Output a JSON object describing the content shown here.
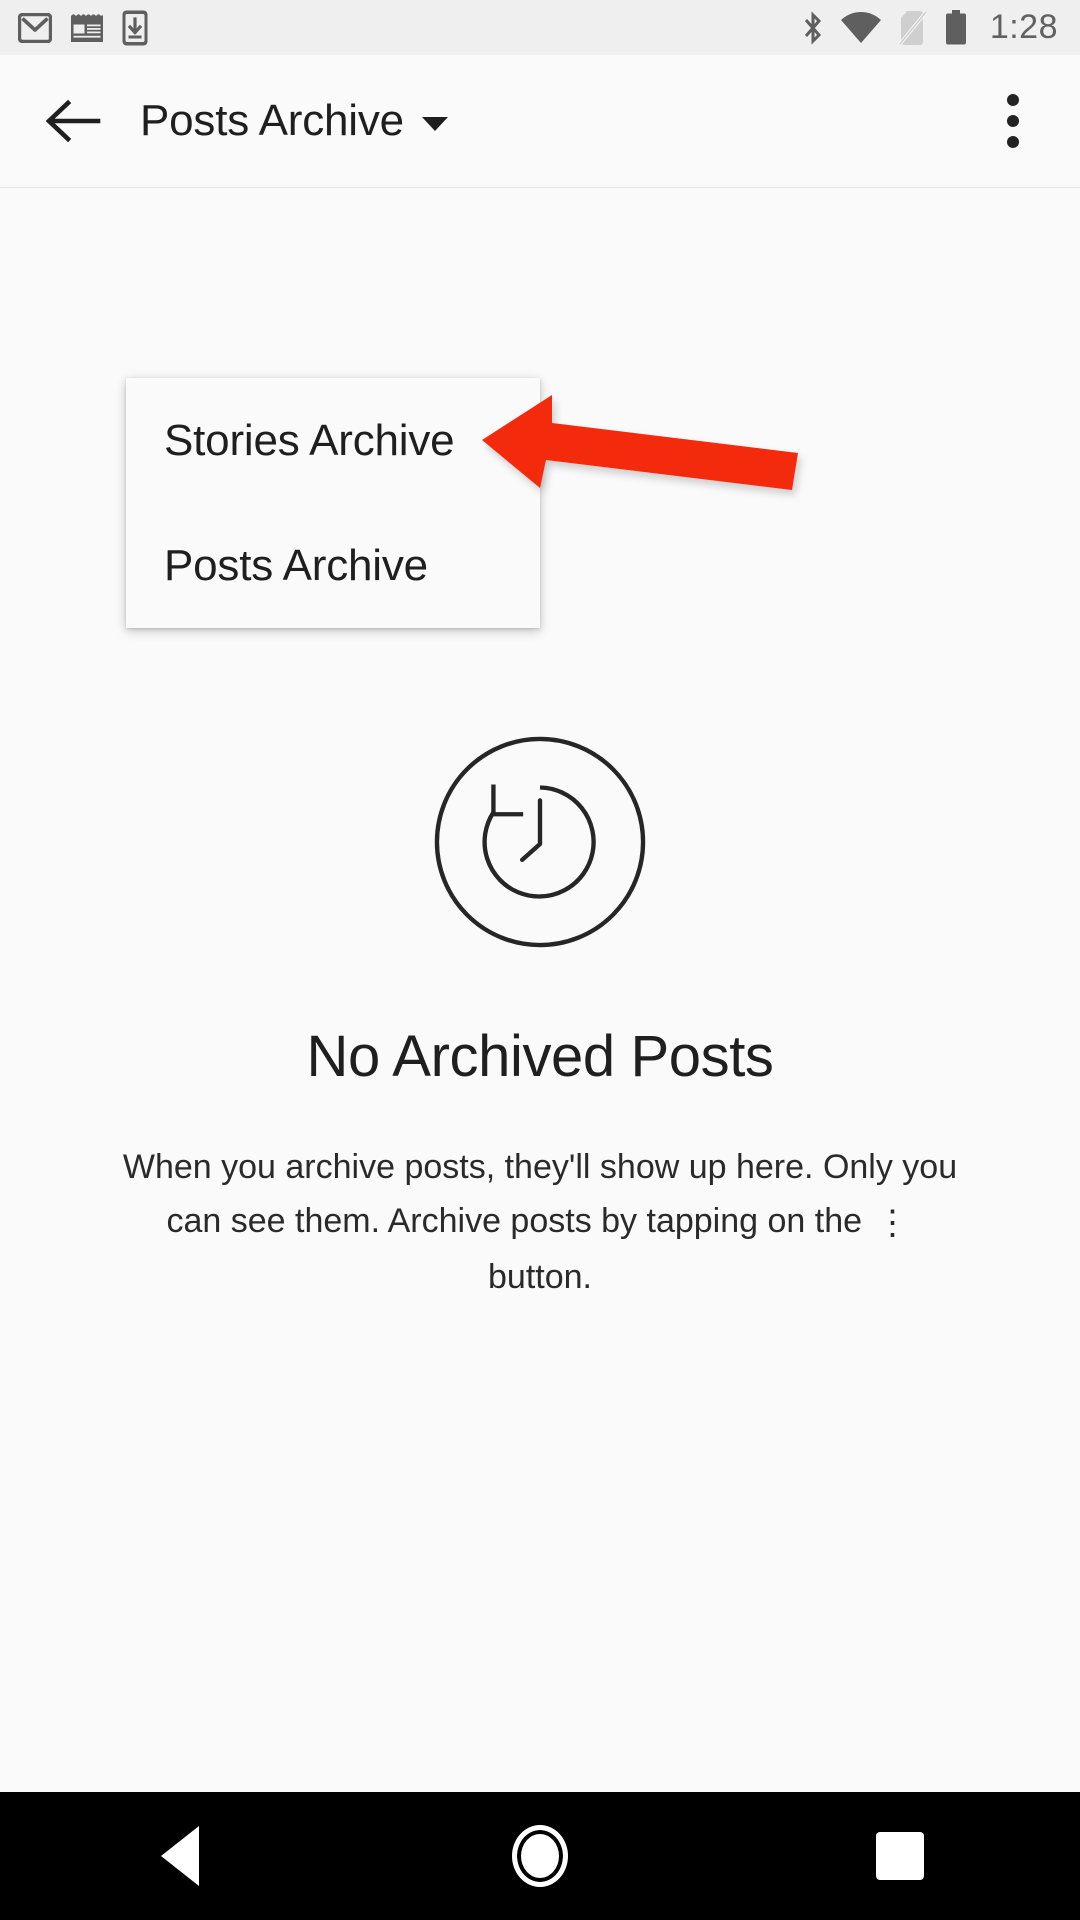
{
  "status_bar": {
    "left_icons": [
      "gmail-icon",
      "news-icon",
      "download-to-device-icon"
    ],
    "right_icons": [
      "bluetooth-icon",
      "wifi-icon",
      "no-sim-icon",
      "battery-icon"
    ],
    "time": "1:28",
    "background": "#efefef",
    "icon_color": "#5f5f5f"
  },
  "app_bar": {
    "back_label": "Back",
    "title": "Posts Archive",
    "caret_icon": "chevron-down-icon",
    "overflow_label": "More options",
    "background": "#fafafa",
    "text_color": "#1f1f1f"
  },
  "dropdown_menu": {
    "visible": true,
    "items": [
      {
        "label": "Stories Archive",
        "selected": false
      },
      {
        "label": "Posts Archive",
        "selected": true
      }
    ],
    "background": "#fafafa"
  },
  "annotation": {
    "type": "arrow",
    "color": "#F42B0C",
    "points_to": "Stories Archive",
    "direction": "left"
  },
  "empty_state": {
    "icon": "archive-history-clock-icon",
    "title": "No Archived Posts",
    "body_line_1": "When you archive posts, they'll show up here.",
    "body_line_2": "Only you can see them. Archive posts by tapping",
    "body_line_3_before": "on the",
    "body_line_3_dots": "⋮",
    "body_line_3_after": "button.",
    "icon_color": "#262626",
    "title_color": "#1f1f1f",
    "body_color": "#2a2a2a"
  },
  "nav_bar": {
    "background": "#000000",
    "buttons": [
      {
        "name": "back",
        "icon": "triangle-back-icon"
      },
      {
        "name": "home",
        "icon": "circle-home-icon"
      },
      {
        "name": "recents",
        "icon": "square-recents-icon"
      }
    ]
  }
}
